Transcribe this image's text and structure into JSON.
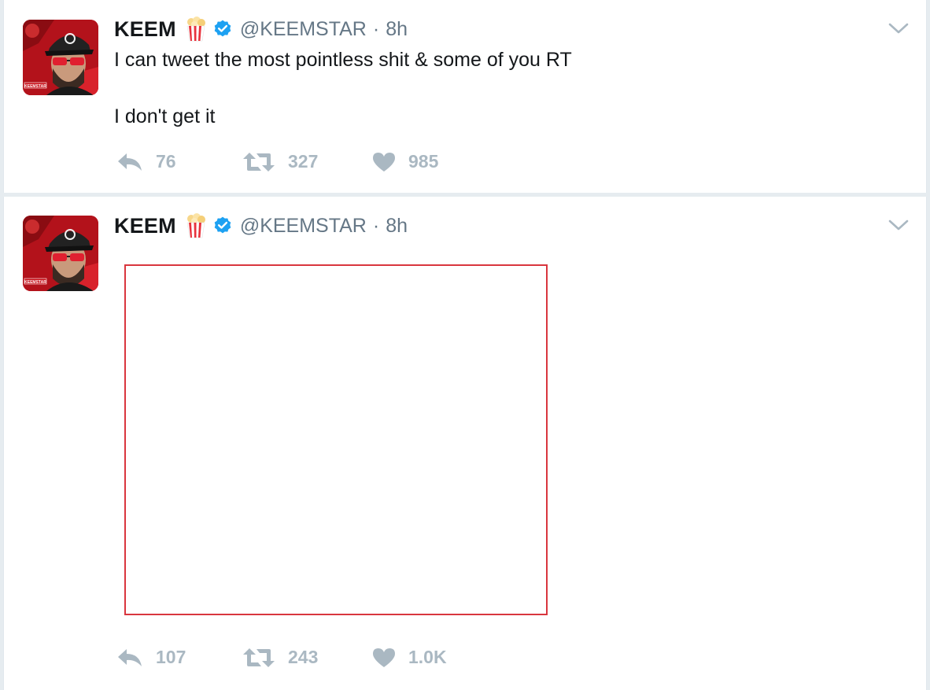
{
  "tweets": [
    {
      "name": "KEEM",
      "handle": "@KEEMSTAR",
      "separator": "·",
      "time": "8h",
      "text": "I can tweet the most pointless shit & some of you RT\n\nI don't get it",
      "reply_count": "76",
      "retweet_count": "327",
      "like_count": "985",
      "avatar_badge": "KEEMSTAR"
    },
    {
      "name": "KEEM",
      "handle": "@KEEMSTAR",
      "separator": "·",
      "time": "8h",
      "reply_count": "107",
      "retweet_count": "243",
      "like_count": "1.0K",
      "avatar_badge": "KEEMSTAR"
    }
  ],
  "colors": {
    "text_primary": "#14171a",
    "text_secondary": "#657786",
    "action_gray": "#aab8c2",
    "verified_blue": "#1da1f2",
    "media_border": "#d9363e"
  },
  "icons": {
    "reply": "reply-icon",
    "retweet": "retweet-icon",
    "like": "heart-icon",
    "verified": "verified-badge-icon",
    "emoji": "popcorn-icon",
    "menu": "chevron-down-icon"
  }
}
